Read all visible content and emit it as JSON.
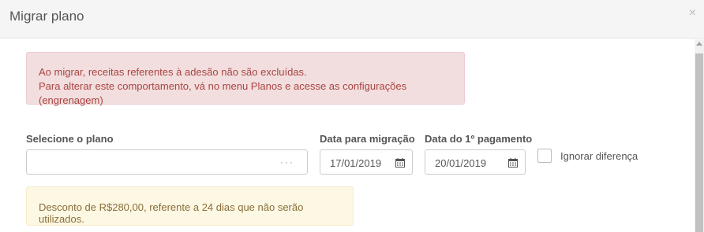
{
  "modal": {
    "title": "Migrar plano",
    "close_glyph": "×"
  },
  "alert_danger": {
    "line1": "Ao migrar, receitas referentes à adesão não são excluídas.",
    "line2": "Para alterar este comportamento, vá no menu Planos e acesse as configurações (engrenagem)"
  },
  "form": {
    "plan_label": "Selecione o plano",
    "plan_value": "",
    "plan_dots": "···",
    "migration_date_label": "Data para migração",
    "migration_date_value": "17/01/2019",
    "first_payment_label": "Data do 1º pagamento",
    "first_payment_value": "20/01/2019",
    "ignore_diff_label": "Ignorar diferença",
    "ignore_diff_checked": false
  },
  "alert_warning": {
    "text": "Desconto de R$280,00, referente a 24 dias que não serão utilizados."
  },
  "icons": {
    "calendar": "calendar-icon",
    "close": "close-icon"
  }
}
